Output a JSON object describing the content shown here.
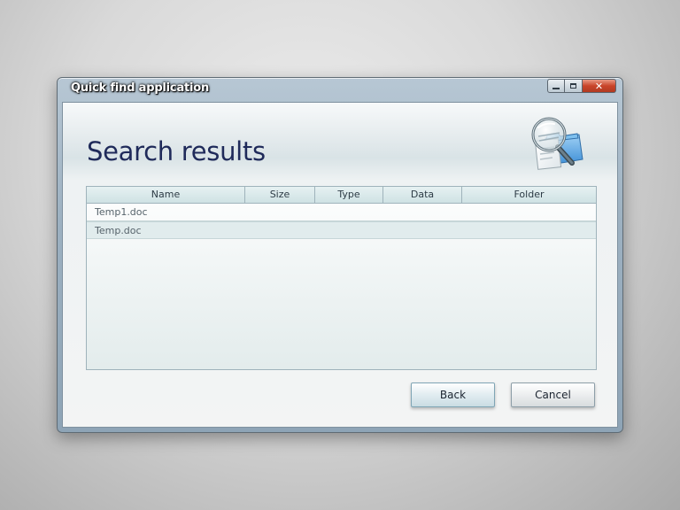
{
  "window": {
    "title": "Quick find application",
    "caption_buttons": {
      "minimize_icon": "minimize-icon",
      "maximize_icon": "maximize-icon",
      "close_glyph": "✕"
    }
  },
  "main": {
    "heading": "Search results",
    "app_icon": "search-folder-magnifier-icon"
  },
  "results_table": {
    "columns": [
      "Name",
      "Size",
      "Type",
      "Data",
      "Folder"
    ],
    "rows": [
      {
        "name": "Temp1.doc",
        "size": "",
        "type": "",
        "data": "",
        "folder": ""
      },
      {
        "name": "Temp.doc",
        "size": "",
        "type": "",
        "data": "",
        "folder": ""
      }
    ]
  },
  "buttons": {
    "back_label": "Back",
    "cancel_label": "Cancel"
  },
  "colors": {
    "heading": "#1f2a5a",
    "close_button": "#c9452a",
    "table_header": "#cfe2e4"
  }
}
